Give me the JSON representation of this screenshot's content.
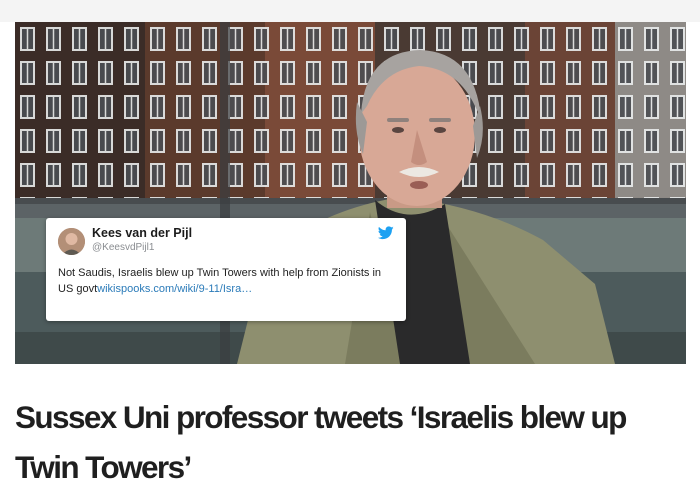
{
  "tweet": {
    "author_name": "Kees van der Pijl",
    "handle": "@KeesvdPijl1",
    "text": "Not Saudis, Israelis blew up Twin Towers  with help from Zionists in US govt",
    "link_text": "wikispooks.com/wiki/9-11/Isra…",
    "icons": {
      "avatar": "author-avatar",
      "brand": "twitter-bird-icon"
    },
    "colors": {
      "link": "#2b7bb9",
      "bird": "#1da1f2"
    }
  },
  "article": {
    "headline": "Sussex Uni professor tweets ‘Israelis blew up Twin Towers’"
  }
}
